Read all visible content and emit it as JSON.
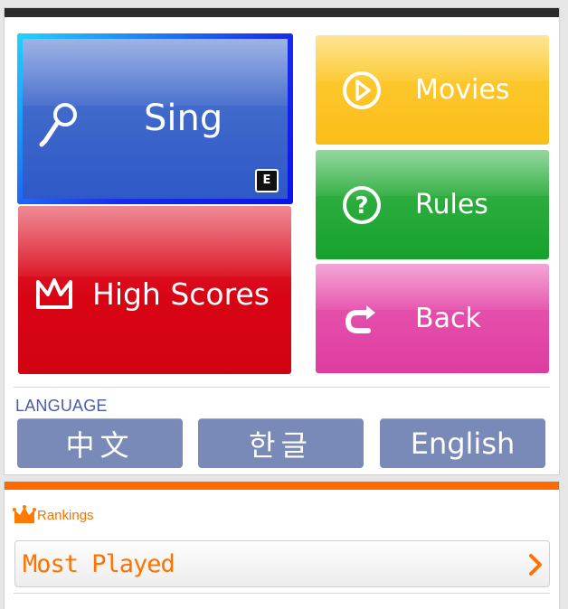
{
  "menu": {
    "sing_label": "Sing",
    "sing_badge": "E",
    "high_scores_label": "High Scores",
    "movies_label": "Movies",
    "rules_label": "Rules",
    "back_label": "Back"
  },
  "language": {
    "title": "LANGUAGE",
    "options": [
      "中文",
      "한글",
      "English"
    ]
  },
  "rankings": {
    "title": "Rankings",
    "most_played_label": "Most Played"
  },
  "icons": {
    "sing": "microphone-icon",
    "high_scores": "crown-icon",
    "movies": "play-circle-icon",
    "rules": "question-circle-icon",
    "back": "return-arrow-icon",
    "rankings": "crown-icon",
    "most_played": "chevron-right-icon"
  },
  "colors": {
    "sing": "#2d58c6",
    "high_scores": "#d80414",
    "movies": "#fbbd18",
    "rules": "#16a12c",
    "back": "#de3da0",
    "language_button": "#7a8ab8",
    "language_title": "#4a5ca8",
    "rankings_accent": "#ff6a00",
    "header_bar": "#2b2b2b"
  }
}
